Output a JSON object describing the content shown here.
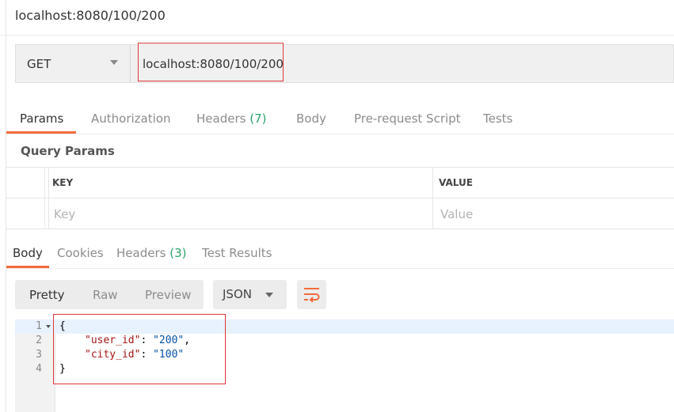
{
  "request": {
    "title": "localhost:8080/100/200",
    "method": "GET",
    "url": "localhost:8080/100/200"
  },
  "request_tabs": {
    "params": "Params",
    "authorization": "Authorization",
    "headers": "Headers",
    "headers_count": "(7)",
    "body": "Body",
    "pre_request_script": "Pre-request Script",
    "tests": "Tests"
  },
  "query_params": {
    "title": "Query Params",
    "key_header": "KEY",
    "value_header": "VALUE",
    "key_placeholder": "Key",
    "value_placeholder": "Value"
  },
  "response_tabs": {
    "body": "Body",
    "cookies": "Cookies",
    "headers": "Headers",
    "headers_count": "(3)",
    "test_results": "Test Results"
  },
  "view_modes": {
    "pretty": "Pretty",
    "raw": "Raw",
    "preview": "Preview",
    "language": "JSON"
  },
  "response_body": {
    "line_numbers": [
      "1",
      "2",
      "3",
      "4"
    ],
    "open_brace": "{",
    "close_brace": "}",
    "user_id_key": "\"user_id\"",
    "user_id_value": "\"200\"",
    "city_id_key": "\"city_id\"",
    "city_id_value": "\"100\"",
    "colon": ": ",
    "comma": ","
  },
  "icons": {
    "method_dropdown": "chevron-down-icon",
    "language_dropdown": "chevron-down-icon",
    "wrap_lines": "wrap-lines-icon",
    "fold": "fold-caret-icon"
  },
  "colors": {
    "accent": "#f26b3a",
    "count_green": "#2ca36a",
    "highlight_red": "#e0353a"
  }
}
